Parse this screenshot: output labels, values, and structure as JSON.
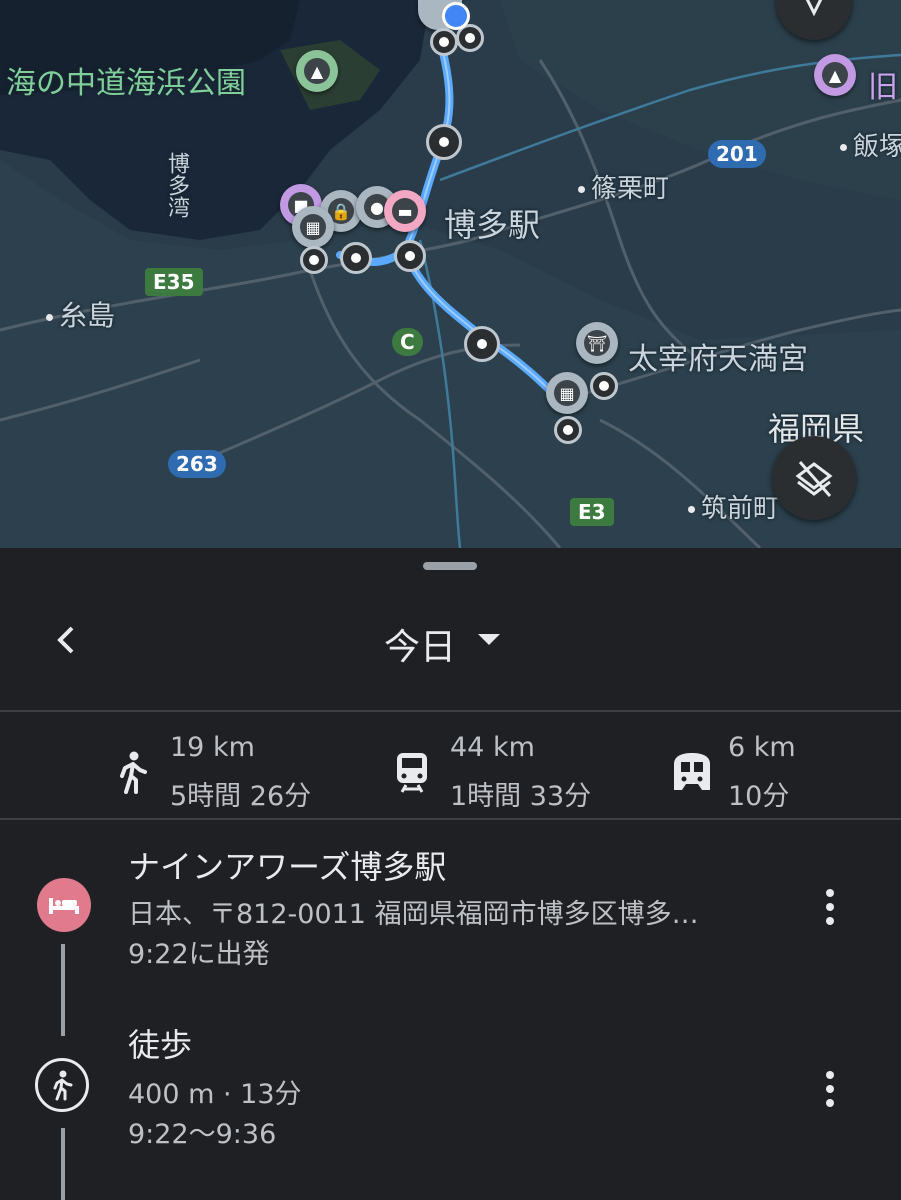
{
  "map": {
    "labels": {
      "park": "海の中道海浜公園",
      "bay": "博多湾",
      "sasaguri": "篠栗町",
      "hakata_station": "博多駅",
      "itoshima": "糸島",
      "dazaifu": "太宰府天満宮",
      "fukuoka_pref": "福岡県",
      "chikuzen": "筑前町",
      "iizuka": "飯塚",
      "kyu": "旧"
    },
    "shields": {
      "e35": "E35",
      "r201": "201",
      "c": "C",
      "r263": "263",
      "e3": "E3"
    },
    "route_color": "#5aa9ff"
  },
  "sheet": {
    "day_selector": "今日",
    "stats": [
      {
        "icon": "walk-icon",
        "distance": "19 km",
        "duration": "5時間 26分"
      },
      {
        "icon": "train-icon",
        "distance": "44 km",
        "duration": "1時間 33分"
      },
      {
        "icon": "subway-icon",
        "distance": "6 km",
        "duration": "10分"
      }
    ],
    "items": [
      {
        "icon": "hotel-icon",
        "title": "ナインアワーズ博多駅",
        "address": "日本、〒812-0011 福岡県福岡市博多区博多…",
        "time": "9:22に出発"
      },
      {
        "icon": "walk-icon",
        "title": "徒歩",
        "detail": "400 m · 13分",
        "time": "9:22〜9:36"
      }
    ]
  }
}
